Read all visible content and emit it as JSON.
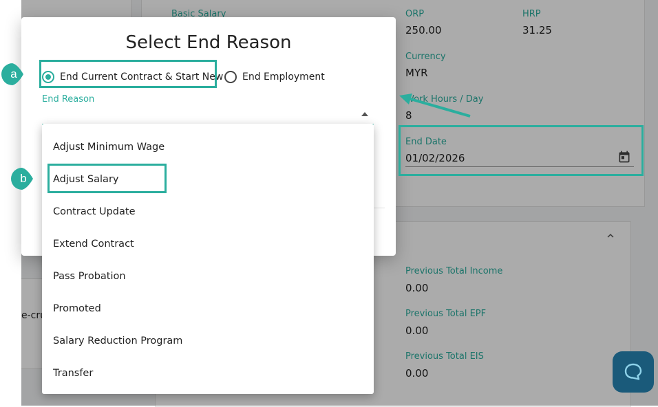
{
  "background": {
    "fields": [
      {
        "label": "Basic Salary",
        "value": ""
      },
      {
        "label": "ORP",
        "value": "250.00"
      },
      {
        "label": "HRP",
        "value": "31.25"
      },
      {
        "label": "Currency",
        "value": "MYR"
      },
      {
        "label": "Work Hours / Day",
        "value": "8"
      },
      {
        "label": "End Date",
        "value": "01/02/2026"
      },
      {
        "label": "Previous Total Income",
        "value": "0.00"
      },
      {
        "label": "Previous Total EPF",
        "value": "0.00"
      },
      {
        "label": "Previous Total EIS",
        "value": "0.00"
      }
    ],
    "truncated_text": "e-cru"
  },
  "modal": {
    "title": "Select End Reason",
    "radio_options": [
      {
        "label": "End Current Contract & Start New",
        "selected": true
      },
      {
        "label": "End Employment",
        "selected": false
      }
    ],
    "field_label": "End Reason"
  },
  "dropdown": {
    "options": [
      "Adjust Minimum Wage",
      "Adjust Salary",
      "Contract Update",
      "Extend Contract",
      "Pass Probation",
      "Promoted",
      "Salary Reduction Program",
      "Transfer"
    ],
    "highlighted_option": "Adjust Salary"
  },
  "annotations": {
    "markers": [
      "a",
      "b"
    ],
    "accent_color": "#2bae9e"
  },
  "colors": {
    "accent": "#2bae9e",
    "chat_button": "#1a5a7a",
    "overlay": "rgba(0,0,0,0.33)"
  }
}
